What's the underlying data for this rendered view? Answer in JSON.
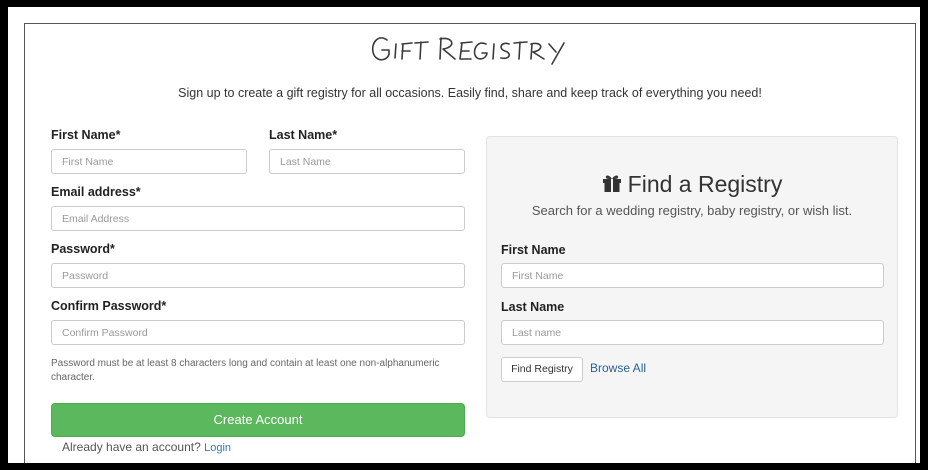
{
  "logo": {
    "text": "Gift Registry"
  },
  "tagline": "Sign up to create a gift registry for all occasions. Easily find, share and keep track of everything you need!",
  "signup": {
    "first_name_label": "First Name*",
    "first_name_placeholder": "First Name",
    "last_name_label": "Last Name*",
    "last_name_placeholder": "Last Name",
    "email_label": "Email address*",
    "email_placeholder": "Email Address",
    "password_label": "Password*",
    "password_placeholder": "Password",
    "confirm_label": "Confirm Password*",
    "confirm_placeholder": "Confirm Password",
    "hint": "Password must be at least 8 characters long and contain at least one non-alphanumeric character.",
    "create_button": "Create Account",
    "already_text": "Already have an account?",
    "login_link": "Login"
  },
  "find": {
    "icon": "gift-icon",
    "title": "Find a Registry",
    "subtitle": "Search for a wedding registry, baby registry, or wish list.",
    "first_name_label": "First Name",
    "first_name_placeholder": "First Name",
    "last_name_label": "Last Name",
    "last_name_placeholder": "Last name",
    "find_button": "Find Registry",
    "browse_link": "Browse All"
  },
  "colors": {
    "primary_button": "#5cb85c",
    "link": "#337ab7",
    "panel_bg": "#f5f5f5"
  }
}
